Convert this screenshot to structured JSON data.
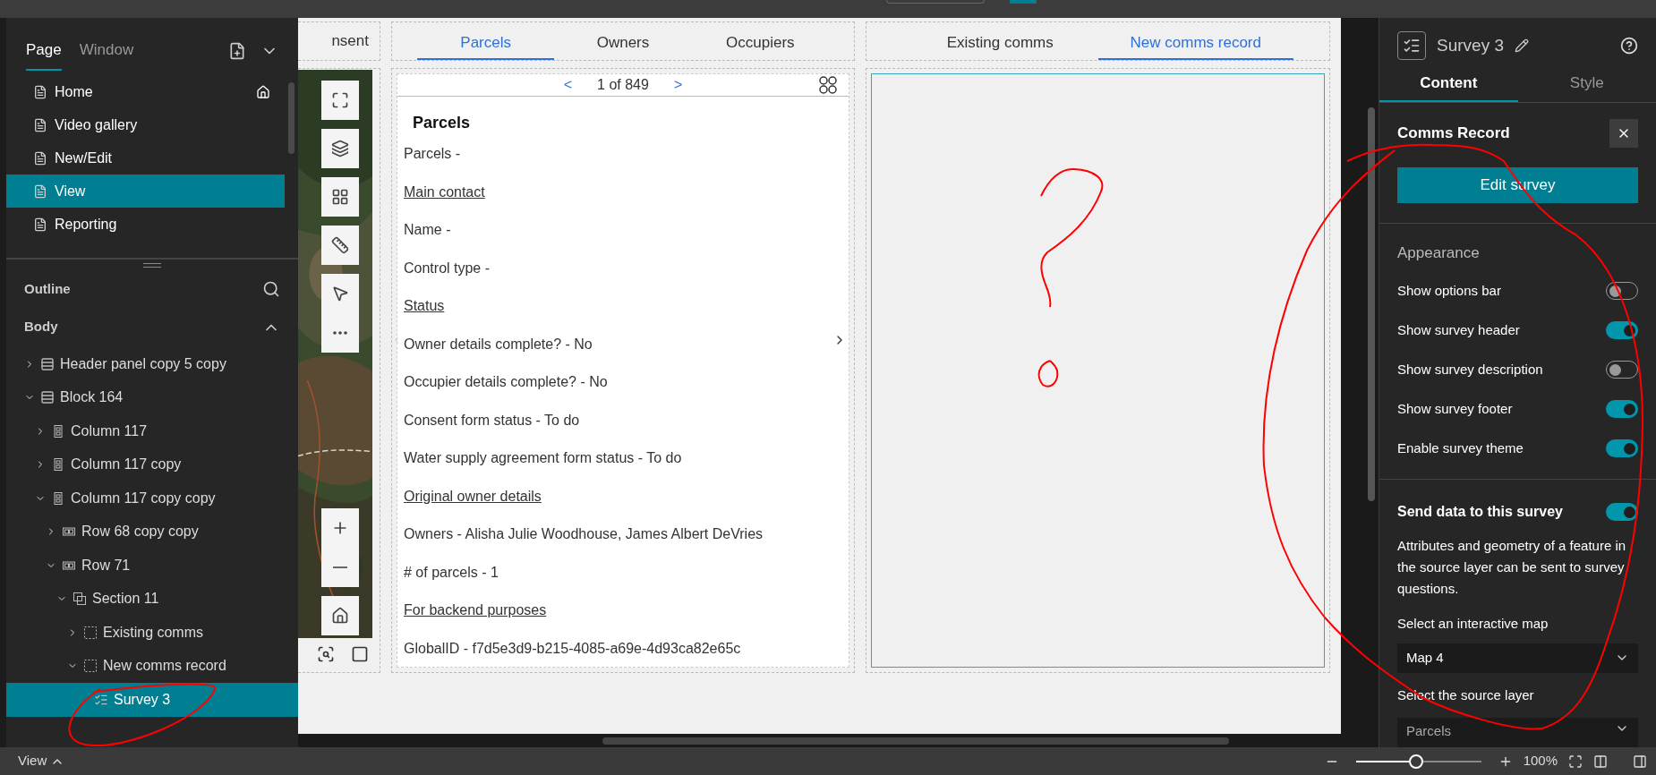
{
  "left_panel": {
    "tabs": [
      {
        "label": "Page",
        "selected": true
      },
      {
        "label": "Window",
        "selected": false
      }
    ],
    "pages": [
      {
        "label": "Home",
        "home": true,
        "selected": false
      },
      {
        "label": "Video gallery",
        "home": false,
        "selected": false
      },
      {
        "label": "New/Edit",
        "home": false,
        "selected": false
      },
      {
        "label": "View",
        "home": false,
        "selected": true
      },
      {
        "label": "Reporting",
        "home": false,
        "selected": false
      }
    ],
    "outline_title": "Outline",
    "body_title": "Body",
    "tree": [
      {
        "label": "Header panel copy 5 copy",
        "kind": "block",
        "expanded": false,
        "selected": false
      },
      {
        "label": "Block 164",
        "kind": "block",
        "expanded": true,
        "selected": false,
        "children": [
          {
            "label": "Column 117",
            "kind": "column",
            "expanded": false,
            "selected": false
          },
          {
            "label": "Column 117 copy",
            "kind": "column",
            "expanded": false,
            "selected": false
          },
          {
            "label": "Column 117 copy copy",
            "kind": "column",
            "expanded": true,
            "selected": false,
            "children": [
              {
                "label": "Row 68 copy copy",
                "kind": "row",
                "expanded": false,
                "selected": false
              },
              {
                "label": "Row 71",
                "kind": "row",
                "expanded": true,
                "selected": false,
                "children": [
                  {
                    "label": "Section 11",
                    "kind": "section",
                    "expanded": true,
                    "selected": false,
                    "children": [
                      {
                        "label": "Existing comms",
                        "kind": "view",
                        "expanded": false,
                        "selected": false
                      },
                      {
                        "label": "New comms record",
                        "kind": "view",
                        "expanded": true,
                        "selected": false,
                        "children": [
                          {
                            "label": "Survey 3",
                            "kind": "survey",
                            "selected": true
                          }
                        ]
                      }
                    ]
                  }
                ]
              }
            ]
          }
        ]
      }
    ]
  },
  "canvas": {
    "map_column": {
      "tab": "nsent"
    },
    "parcels_panel": {
      "tabs": [
        {
          "label": "Parcels",
          "selected": true
        },
        {
          "label": "Owners",
          "selected": false
        },
        {
          "label": "Occupiers",
          "selected": false
        }
      ],
      "pager": {
        "prev": "<",
        "position": "1 of 849",
        "next": ">"
      },
      "heading": "Parcels",
      "lines": [
        {
          "kind": "text",
          "text": "Parcels -"
        },
        {
          "kind": "section",
          "text": "Main contact"
        },
        {
          "kind": "text",
          "text": "Name -"
        },
        {
          "kind": "text",
          "text": "Control type -"
        },
        {
          "kind": "section",
          "text": "Status"
        },
        {
          "kind": "text",
          "text": "Owner details complete? - No"
        },
        {
          "kind": "text",
          "text": "Occupier details complete? - No"
        },
        {
          "kind": "text",
          "text": "Consent form status - To do"
        },
        {
          "kind": "text",
          "text": "Water supply agreement form status - To do"
        },
        {
          "kind": "section",
          "text": "Original owner details"
        },
        {
          "kind": "text",
          "text": "Owners - Alisha Julie Woodhouse, James Albert DeVries"
        },
        {
          "kind": "text",
          "text": "# of parcels - 1"
        },
        {
          "kind": "section",
          "text": "For backend purposes"
        },
        {
          "kind": "text",
          "text": "GlobalID - f7d5e3d9-b215-4085-a69e-4d93ca82e65c"
        }
      ]
    },
    "comms_panel": {
      "tabs": [
        {
          "label": "Existing comms",
          "selected": false
        },
        {
          "label": "New comms record",
          "selected": true
        }
      ]
    }
  },
  "right_panel": {
    "title": "Survey 3",
    "tabs": [
      {
        "label": "Content",
        "selected": true
      },
      {
        "label": "Style",
        "selected": false
      }
    ],
    "survey_name": "Comms Record",
    "edit_button": "Edit survey",
    "appearance_title": "Appearance",
    "toggles": [
      {
        "label": "Show options bar",
        "on": false
      },
      {
        "label": "Show survey header",
        "on": true
      },
      {
        "label": "Show survey description",
        "on": false
      },
      {
        "label": "Show survey footer",
        "on": true
      },
      {
        "label": "Enable survey theme",
        "on": true
      }
    ],
    "send_data": {
      "label": "Send data to this survey",
      "on": true
    },
    "description": "Attributes and geometry of a feature in the source layer can be sent to survey questions.",
    "map_label": "Select an interactive map",
    "map_value": "Map 4",
    "layer_label": "Select the source layer",
    "layer_value": "Parcels"
  },
  "status_bar": {
    "page": "View",
    "zoom": "100%",
    "zoom_slider": {
      "level": 0.48
    }
  }
}
